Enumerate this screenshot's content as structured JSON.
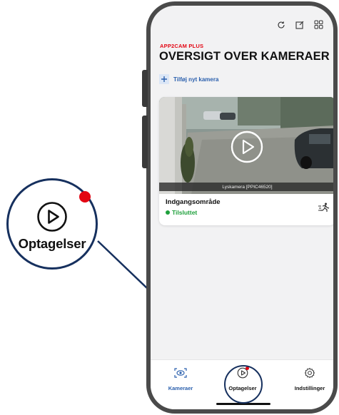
{
  "header": {
    "brand": "APP2CAM PLUS",
    "title": "OVERSIGT OVER KAMERAER",
    "add_camera_label": "Tilføj nyt kamera",
    "icons": [
      "refresh-icon",
      "edit-icon",
      "grid-icon"
    ]
  },
  "camera_card": {
    "overlay_label": "Lyskamera [PPIC46520]",
    "name": "Indgangsområde",
    "status": "Tilsluttet",
    "status_color": "#1fa03c",
    "icons": [
      "play-icon",
      "motion-detection-icon"
    ]
  },
  "bottom_nav": {
    "items": [
      {
        "label": "Kameraer",
        "icon": "camera-eye-icon",
        "active": true
      },
      {
        "label": "Optagelser",
        "icon": "play-circle-icon",
        "badge": true
      },
      {
        "label": "Indstillinger",
        "icon": "gear-icon"
      }
    ]
  },
  "callout": {
    "label": "Optagelser",
    "icon": "play-circle-icon"
  },
  "colors": {
    "brand_red": "#e30613",
    "accent_blue": "#2a5fad",
    "callout_navy": "#16305e"
  }
}
